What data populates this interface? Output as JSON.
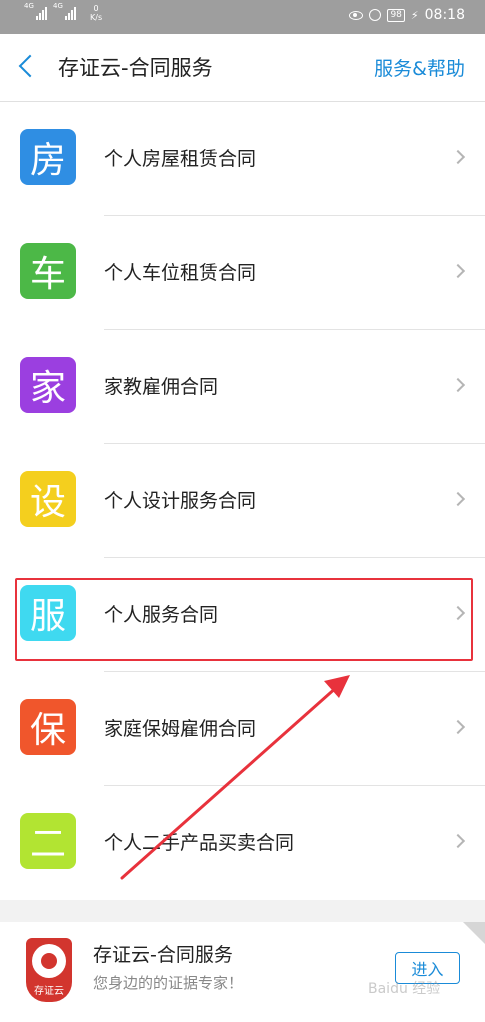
{
  "status_bar": {
    "network_1": "4G",
    "network_2": "4G",
    "speed_value": "0",
    "speed_unit": "K/s",
    "battery": "98",
    "time": "08:18"
  },
  "header": {
    "title": "存证云-合同服务",
    "help": "服务&帮助"
  },
  "items": [
    {
      "badge": "房",
      "label": "个人房屋租赁合同",
      "color": "#2f8ee3"
    },
    {
      "badge": "车",
      "label": "个人车位租赁合同",
      "color": "#4cb847"
    },
    {
      "badge": "家",
      "label": "家教雇佣合同",
      "color": "#9b3fe0"
    },
    {
      "badge": "设",
      "label": "个人设计服务合同",
      "color": "#f4cf1e"
    },
    {
      "badge": "服",
      "label": "个人服务合同",
      "color": "#3fd9f0"
    },
    {
      "badge": "保",
      "label": "家庭保姆雇佣合同",
      "color": "#f0562c"
    },
    {
      "badge": "二",
      "label": "个人二手产品买卖合同",
      "color": "#b2e432"
    }
  ],
  "banner": {
    "logo_text": "存证云",
    "name": "存证云-合同服务",
    "slogan": "您身边的的证据专家！",
    "enter": "进入"
  },
  "watermark": "Baidu 经验"
}
